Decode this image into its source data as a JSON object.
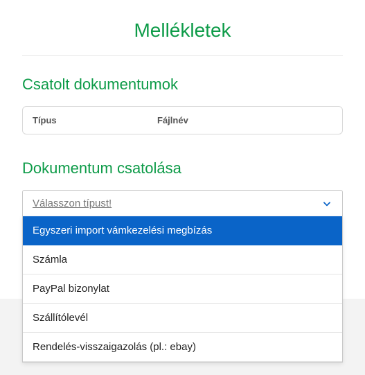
{
  "page_title": "Mellékletek",
  "attached_section": {
    "title": "Csatolt dokumentumok",
    "columns": {
      "type": "Típus",
      "filename": "Fájlnév"
    }
  },
  "attach_section": {
    "title": "Dokumentum csatolása",
    "placeholder": "Válasszon típust!",
    "options": [
      "Egyszeri import vámkezelési megbízás",
      "Számla",
      "PayPal bizonylat",
      "Szállítólevél",
      "Rendelés-visszaigazolás (pl.: ebay)"
    ],
    "selected_index": 0
  },
  "colors": {
    "accent": "#0d9b48",
    "select_highlight": "#0a64c8"
  }
}
